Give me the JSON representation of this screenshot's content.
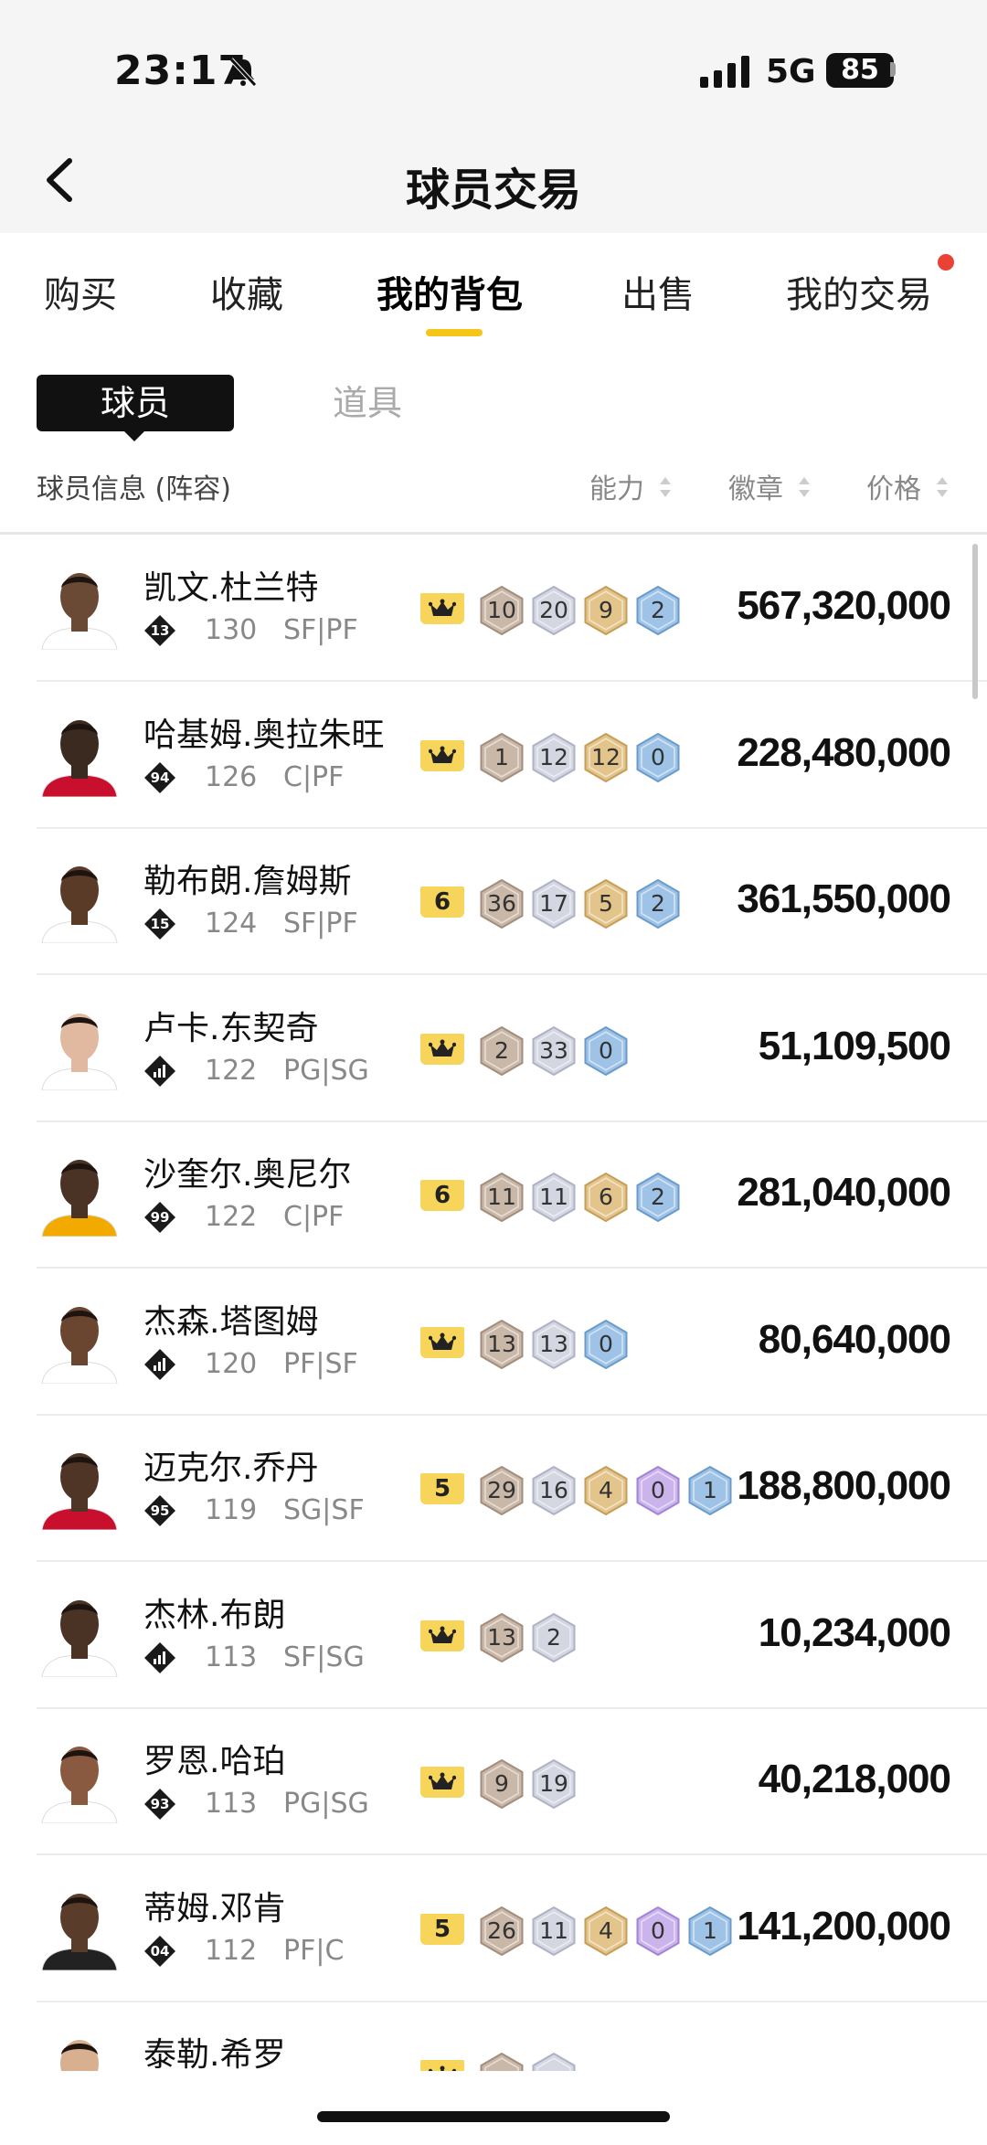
{
  "status": {
    "time": "23:17",
    "network": "5G",
    "battery": "85"
  },
  "nav": {
    "title": "球员交易"
  },
  "tabs": [
    {
      "label": "购买",
      "active": false
    },
    {
      "label": "收藏",
      "active": false
    },
    {
      "label": "我的背包",
      "active": true
    },
    {
      "label": "出售",
      "active": false
    },
    {
      "label": "我的交易",
      "active": false,
      "has_dot": true
    }
  ],
  "segments": {
    "active": "球员",
    "inactive": "道具"
  },
  "columns": {
    "info": "球员信息 (阵容)",
    "ability": "能力",
    "badges": "徽章",
    "price": "价格"
  },
  "colors": {
    "accent": "#f5c518",
    "notification": "#ea4335",
    "tier_bg": "#f7d55b"
  },
  "players": [
    {
      "name": "凯文.杜兰特",
      "rating_badge": "13",
      "ability": "130",
      "position": "SF|PF",
      "tier": "crown",
      "badges": [
        {
          "type": "bronze",
          "value": "10"
        },
        {
          "type": "silver",
          "value": "20"
        },
        {
          "type": "gold",
          "value": "9"
        },
        {
          "type": "blue",
          "value": "2"
        }
      ],
      "price": "567,320,000",
      "skin": "#6b4a35",
      "jersey": "#ffffff"
    },
    {
      "name": "哈基姆.奥拉朱旺",
      "rating_badge": "94",
      "ability": "126",
      "position": "C|PF",
      "tier": "crown",
      "badges": [
        {
          "type": "bronze",
          "value": "1"
        },
        {
          "type": "silver",
          "value": "12"
        },
        {
          "type": "gold",
          "value": "12"
        },
        {
          "type": "blue",
          "value": "0"
        }
      ],
      "price": "228,480,000",
      "skin": "#3b2a20",
      "jersey": "#c8102e"
    },
    {
      "name": "勒布朗.詹姆斯",
      "rating_badge": "15",
      "ability": "124",
      "position": "SF|PF",
      "tier": "6",
      "badges": [
        {
          "type": "bronze",
          "value": "36"
        },
        {
          "type": "silver",
          "value": "17"
        },
        {
          "type": "gold",
          "value": "5"
        },
        {
          "type": "blue",
          "value": "2"
        }
      ],
      "price": "361,550,000",
      "skin": "#5a3b28",
      "jersey": "#ffffff"
    },
    {
      "name": "卢卡.东契奇",
      "rating_badge": "",
      "ability": "122",
      "position": "PG|SG",
      "tier": "crown",
      "badges": [
        {
          "type": "bronze",
          "value": "2"
        },
        {
          "type": "silver",
          "value": "33"
        },
        {
          "type": "blue",
          "value": "0"
        }
      ],
      "price": "51,109,500",
      "skin": "#e0b9a0",
      "jersey": "#ffffff"
    },
    {
      "name": "沙奎尔.奥尼尔",
      "rating_badge": "99",
      "ability": "122",
      "position": "C|PF",
      "tier": "6",
      "badges": [
        {
          "type": "bronze",
          "value": "11"
        },
        {
          "type": "silver",
          "value": "11"
        },
        {
          "type": "gold",
          "value": "6"
        },
        {
          "type": "blue",
          "value": "2"
        }
      ],
      "price": "281,040,000",
      "skin": "#4a3325",
      "jersey": "#f2a900"
    },
    {
      "name": "杰森.塔图姆",
      "rating_badge": "",
      "ability": "120",
      "position": "PF|SF",
      "tier": "crown",
      "badges": [
        {
          "type": "bronze",
          "value": "13"
        },
        {
          "type": "silver",
          "value": "13"
        },
        {
          "type": "blue",
          "value": "0"
        }
      ],
      "price": "80,640,000",
      "skin": "#6a4530",
      "jersey": "#ffffff"
    },
    {
      "name": "迈克尔.乔丹",
      "rating_badge": "95",
      "ability": "119",
      "position": "SG|SF",
      "tier": "5",
      "badges": [
        {
          "type": "bronze",
          "value": "29"
        },
        {
          "type": "silver",
          "value": "16"
        },
        {
          "type": "gold",
          "value": "4"
        },
        {
          "type": "purple",
          "value": "0"
        },
        {
          "type": "blue",
          "value": "1"
        }
      ],
      "price": "188,800,000",
      "skin": "#4f3526",
      "jersey": "#c8102e"
    },
    {
      "name": "杰林.布朗",
      "rating_badge": "",
      "ability": "113",
      "position": "SF|SG",
      "tier": "crown",
      "badges": [
        {
          "type": "bronze",
          "value": "13"
        },
        {
          "type": "silver",
          "value": "2"
        }
      ],
      "price": "10,234,000",
      "skin": "#4a3224",
      "jersey": "#ffffff"
    },
    {
      "name": "罗恩.哈珀",
      "rating_badge": "93",
      "ability": "113",
      "position": "PG|SG",
      "tier": "crown",
      "badges": [
        {
          "type": "bronze",
          "value": "9"
        },
        {
          "type": "silver",
          "value": "19"
        }
      ],
      "price": "40,218,000",
      "skin": "#8a5a40",
      "jersey": "#ffffff"
    },
    {
      "name": "蒂姆.邓肯",
      "rating_badge": "04",
      "ability": "112",
      "position": "PF|C",
      "tier": "5",
      "badges": [
        {
          "type": "bronze",
          "value": "26"
        },
        {
          "type": "silver",
          "value": "11"
        },
        {
          "type": "gold",
          "value": "4"
        },
        {
          "type": "purple",
          "value": "0"
        },
        {
          "type": "blue",
          "value": "1"
        }
      ],
      "price": "141,200,000",
      "skin": "#5a3c2a",
      "jersey": "#222222"
    },
    {
      "name": "泰勒.希罗",
      "rating_badge": "",
      "ability": "",
      "position": "",
      "tier": "crown",
      "badges": [
        {
          "type": "bronze",
          "value": ""
        },
        {
          "type": "silver",
          "value": ""
        }
      ],
      "price": "",
      "skin": "#d9b08f",
      "jersey": "#ffffff"
    }
  ]
}
